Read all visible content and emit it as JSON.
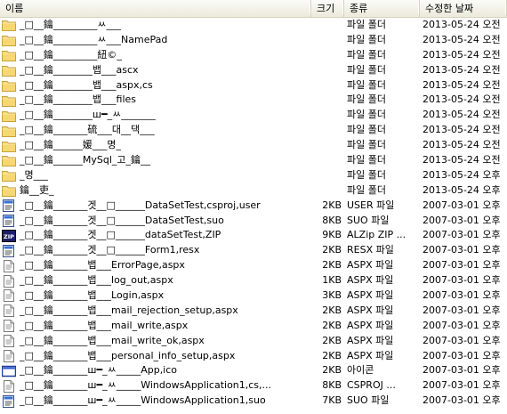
{
  "columns": {
    "name": "이름",
    "size": "크기",
    "type": "종류",
    "modified": "수정한 날짜"
  },
  "rows": [
    {
      "icon": "folder-icon",
      "name": "_□__鑰_________ㅆ___",
      "size": "",
      "type": "파일 폴더",
      "modified": "2013-05-24 오전"
    },
    {
      "icon": "folder-icon",
      "name": "_□__鑰_________ㅆ___NamePad",
      "size": "",
      "type": "파일 폴더",
      "modified": "2013-05-24 오전"
    },
    {
      "icon": "folder-icon",
      "name": "_□__鑰_________紐©_",
      "size": "",
      "type": "파일 폴더",
      "modified": "2013-05-24 오전"
    },
    {
      "icon": "folder-icon",
      "name": "_□__鑰________뱁___ascx",
      "size": "",
      "type": "파일 폴더",
      "modified": "2013-05-24 오전"
    },
    {
      "icon": "folder-icon",
      "name": "_□__鑰________뱁___aspx,cs",
      "size": "",
      "type": "파일 폴더",
      "modified": "2013-05-24 오전"
    },
    {
      "icon": "folder-icon",
      "name": "_□__鑰________뱁___files",
      "size": "",
      "type": "파일 폴더",
      "modified": "2013-05-24 오전"
    },
    {
      "icon": "folder-icon",
      "name": "_□__鑰________ш━_ㅆ_______",
      "size": "",
      "type": "파일 폴더",
      "modified": "2013-05-24 오전"
    },
    {
      "icon": "folder-icon",
      "name": "_□__鑰_______硫___대__댁___",
      "size": "",
      "type": "파일 폴더",
      "modified": "2013-05-24 오전"
    },
    {
      "icon": "folder-icon",
      "name": "_□__鑰______媛___명_",
      "size": "",
      "type": "파일 폴더",
      "modified": "2013-05-24 오전"
    },
    {
      "icon": "folder-icon",
      "name": "_□__鑰______MySql_고_鑰__",
      "size": "",
      "type": "파일 폴더",
      "modified": "2013-05-24 오전"
    },
    {
      "icon": "folder-icon",
      "name": "_명___",
      "size": "",
      "type": "파일 폴더",
      "modified": "2013-05-24 오후"
    },
    {
      "icon": "folder-icon",
      "name": "鑰__吏_",
      "size": "",
      "type": "파일 폴더",
      "modified": "2013-05-24 오후"
    },
    {
      "icon": "user-file-icon",
      "name": "_□__鑰_______겟__□______DataSetTest,csproj,user",
      "size": "2KB",
      "type": "USER 파일",
      "modified": "2007-03-01 오후"
    },
    {
      "icon": "suo-file-icon",
      "name": "_□__鑰_______겟__□______DataSetTest,suo",
      "size": "8KB",
      "type": "SUO 파일",
      "modified": "2007-03-01 오후"
    },
    {
      "icon": "zip-file-icon",
      "name": "_□__鑰_______겟__□______dataSetTest,ZIP",
      "size": "9KB",
      "type": "ALZip ZIP ...",
      "modified": "2007-03-01 오후"
    },
    {
      "icon": "resx-file-icon",
      "name": "_□__鑰_______겟__□______Form1,resx",
      "size": "2KB",
      "type": "RESX 파일",
      "modified": "2007-03-01 오후"
    },
    {
      "icon": "aspx-file-icon",
      "name": "_□__鑰_______뱁___ErrorPage,aspx",
      "size": "2KB",
      "type": "ASPX 파일",
      "modified": "2007-03-01 오후"
    },
    {
      "icon": "aspx-file-icon",
      "name": "_□__鑰_______뱁___log_out,aspx",
      "size": "1KB",
      "type": "ASPX 파일",
      "modified": "2007-03-01 오후"
    },
    {
      "icon": "aspx-file-icon",
      "name": "_□__鑰_______뱁___Login,aspx",
      "size": "3KB",
      "type": "ASPX 파일",
      "modified": "2007-03-01 오후"
    },
    {
      "icon": "aspx-file-icon",
      "name": "_□__鑰_______뱁___mail_rejection_setup,aspx",
      "size": "2KB",
      "type": "ASPX 파일",
      "modified": "2007-03-01 오후"
    },
    {
      "icon": "aspx-file-icon",
      "name": "_□__鑰_______뱁___mail_write,aspx",
      "size": "2KB",
      "type": "ASPX 파일",
      "modified": "2007-03-01 오후"
    },
    {
      "icon": "aspx-file-icon",
      "name": "_□__鑰_______뱁___mail_write_ok,aspx",
      "size": "2KB",
      "type": "ASPX 파일",
      "modified": "2007-03-01 오후"
    },
    {
      "icon": "aspx-file-icon",
      "name": "_□__鑰_______뱁___personal_info_setup,aspx",
      "size": "2KB",
      "type": "ASPX 파일",
      "modified": "2007-03-01 오후"
    },
    {
      "icon": "ico-file-icon",
      "name": "_□__鑰_______ш━_ㅆ_____App,ico",
      "size": "2KB",
      "type": "아이콘",
      "modified": "2007-03-01 오후"
    },
    {
      "icon": "csproj-file-icon",
      "name": "_□__鑰_______ш━_ㅆ_____WindowsApplication1,cs,...",
      "size": "8KB",
      "type": "CSPROJ ...",
      "modified": "2007-03-01 오후"
    },
    {
      "icon": "suo-file-icon",
      "name": "_□__鑰_______ш━_ㅆ_____WindowsApplication1,suo",
      "size": "7KB",
      "type": "SUO 파일",
      "modified": "2007-03-01 오후"
    }
  ]
}
